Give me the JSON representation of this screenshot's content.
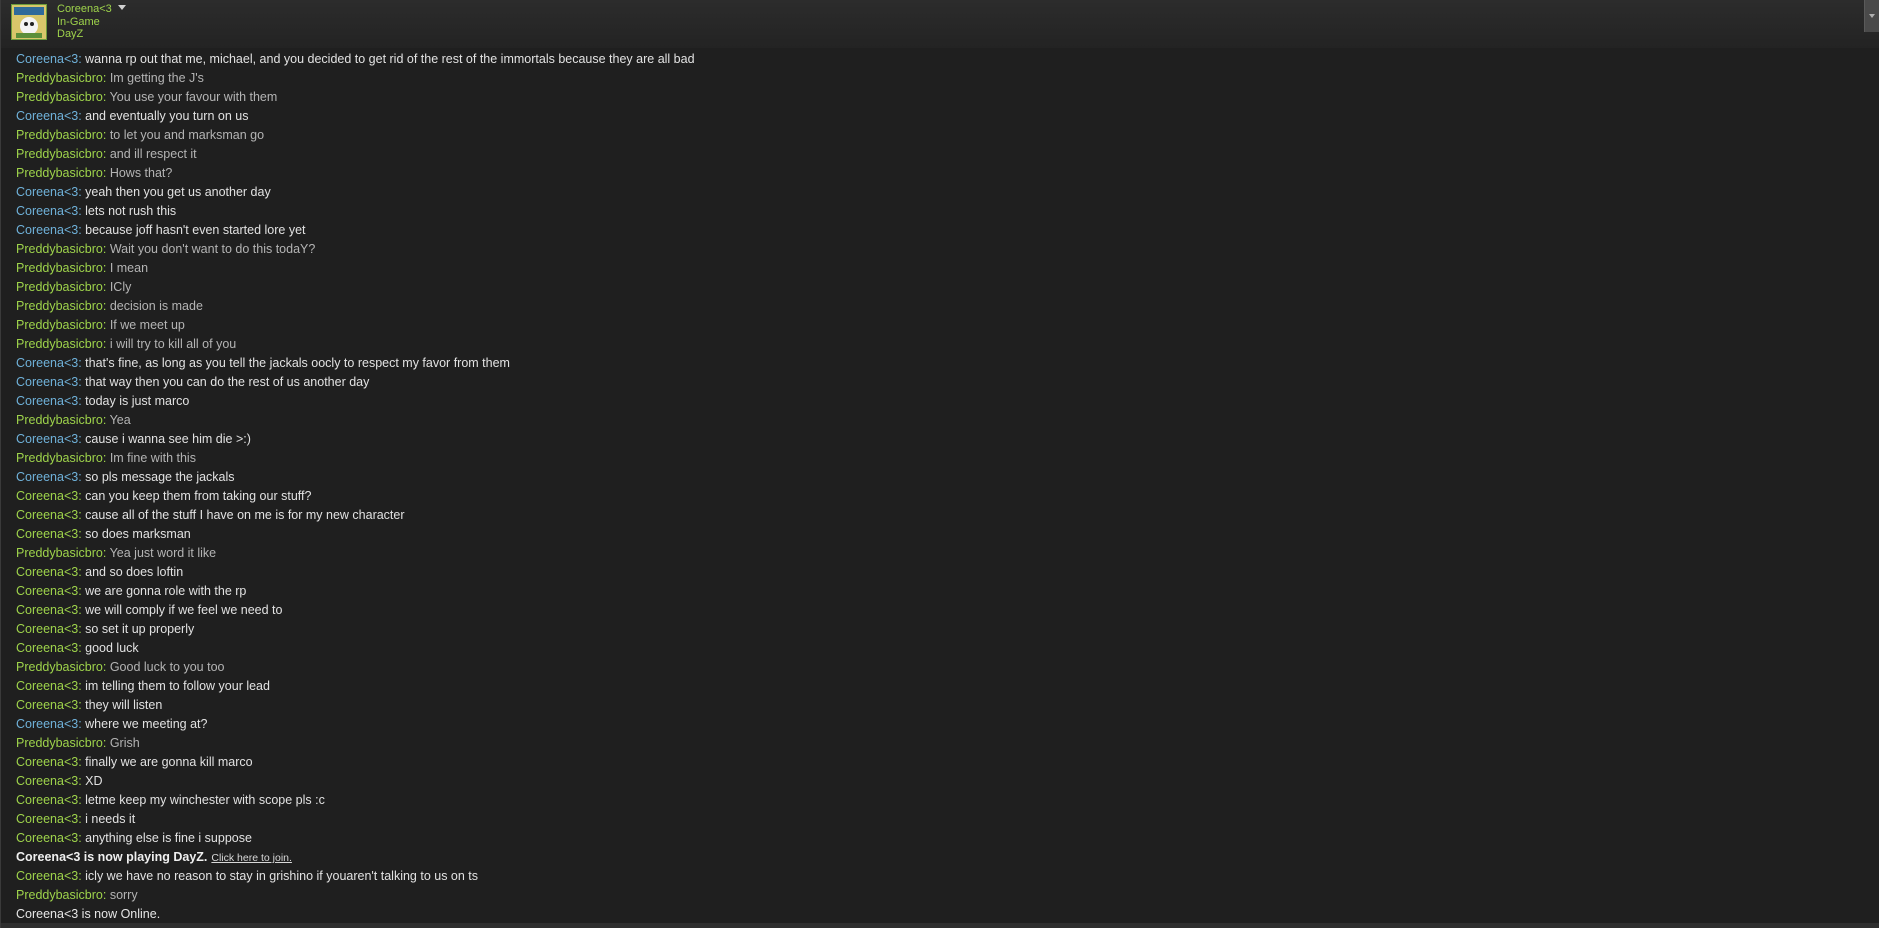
{
  "header": {
    "friend_name": "Coreena<3",
    "status": "In-Game",
    "game": "DayZ"
  },
  "colors": {
    "name_green": "#9ed34b",
    "name_blue": "#6fb1d9",
    "background": "#1f1f1f"
  },
  "messages": [
    {
      "sender": "Coreena<3",
      "sep": ": ",
      "text": "wanna rp out that me, michael, and you decided to get rid of the rest of the immortals because they are all bad",
      "style": "blue"
    },
    {
      "sender": "Preddybasicbro",
      "sep": ": ",
      "text": "Im getting the J's",
      "style": "green"
    },
    {
      "sender": "Preddybasicbro",
      "sep": ": ",
      "text": "You use your favour with them",
      "style": "green"
    },
    {
      "sender": "Coreena<3",
      "sep": ": ",
      "text": "and eventually you turn on us",
      "style": "blue"
    },
    {
      "sender": "Preddybasicbro",
      "sep": ": ",
      "text": "to let you and marksman go",
      "style": "green"
    },
    {
      "sender": "Preddybasicbro",
      "sep": ": ",
      "text": "and ill respect it",
      "style": "green"
    },
    {
      "sender": "Preddybasicbro",
      "sep": ": ",
      "text": "Hows that?",
      "style": "green"
    },
    {
      "sender": "Coreena<3",
      "sep": ": ",
      "text": "yeah then you get us another day",
      "style": "blue"
    },
    {
      "sender": "Coreena<3",
      "sep": ": ",
      "text": "lets not rush this",
      "style": "blue"
    },
    {
      "sender": "Coreena<3",
      "sep": ": ",
      "text": "because joff hasn't even started lore yet",
      "style": "blue"
    },
    {
      "sender": "Preddybasicbro",
      "sep": ": ",
      "text": "Wait you don't want to do this todaY?",
      "style": "green"
    },
    {
      "sender": "Preddybasicbro",
      "sep": ": ",
      "text": "I mean",
      "style": "green"
    },
    {
      "sender": "Preddybasicbro",
      "sep": ": ",
      "text": "ICly",
      "style": "green"
    },
    {
      "sender": "Preddybasicbro",
      "sep": ": ",
      "text": "decision is made",
      "style": "green"
    },
    {
      "sender": "Preddybasicbro",
      "sep": ": ",
      "text": "If we meet up",
      "style": "green"
    },
    {
      "sender": "Preddybasicbro",
      "sep": ": ",
      "text": "i will try to kill all of you",
      "style": "green"
    },
    {
      "sender": "Coreena<3",
      "sep": ": ",
      "text": "that's fine, as long as you tell the jackals oocly to respect my favor from them",
      "style": "blue"
    },
    {
      "sender": "Coreena<3",
      "sep": ": ",
      "text": "that way then you can do the rest of us another day",
      "style": "blue"
    },
    {
      "sender": "Coreena<3",
      "sep": ": ",
      "text": "today is just marco",
      "style": "blue"
    },
    {
      "sender": "Preddybasicbro",
      "sep": ": ",
      "text": "Yea",
      "style": "green"
    },
    {
      "sender": "Coreena<3",
      "sep": ": ",
      "text": "cause i wanna see him die >:)",
      "style": "blue"
    },
    {
      "sender": "Preddybasicbro",
      "sep": ": ",
      "text": "Im fine with this",
      "style": "green"
    },
    {
      "sender": "Coreena<3",
      "sep": ": ",
      "text": "so pls message the jackals",
      "style": "blue"
    },
    {
      "sender": "Coreena<3",
      "sep": ": ",
      "text": "can you keep them from taking our stuff?",
      "style": "green"
    },
    {
      "sender": "Coreena<3",
      "sep": ": ",
      "text": "cause all of the stuff I have on me is for my new character",
      "style": "green"
    },
    {
      "sender": "Coreena<3",
      "sep": ": ",
      "text": "so does marksman",
      "style": "green"
    },
    {
      "sender": "Preddybasicbro",
      "sep": ": ",
      "text": "Yea just word it like",
      "style": "green"
    },
    {
      "sender": "Coreena<3",
      "sep": ": ",
      "text": "and so does loftin",
      "style": "green"
    },
    {
      "sender": "Coreena<3",
      "sep": ": ",
      "text": "we are gonna role with the rp",
      "style": "green"
    },
    {
      "sender": "Coreena<3",
      "sep": ": ",
      "text": "we will comply if we feel we need to",
      "style": "green"
    },
    {
      "sender": "Coreena<3",
      "sep": ": ",
      "text": "so set it up properly",
      "style": "green"
    },
    {
      "sender": "Coreena<3",
      "sep": ": ",
      "text": "good luck",
      "style": "green"
    },
    {
      "sender": "Preddybasicbro",
      "sep": ": ",
      "text": "Good luck to you too",
      "style": "green"
    },
    {
      "sender": "Coreena<3",
      "sep": ": ",
      "text": "im telling them to follow your lead",
      "style": "green"
    },
    {
      "sender": "Coreena<3",
      "sep": ": ",
      "text": "they will listen",
      "style": "green"
    },
    {
      "sender": "Coreena<3",
      "sep": ": ",
      "text": "where we meeting at?",
      "style": "blue"
    },
    {
      "sender": "Preddybasicbro",
      "sep": ": ",
      "text": "Grish",
      "style": "green"
    },
    {
      "sender": "Coreena<3",
      "sep": ": ",
      "text": "finally we are gonna kill marco",
      "style": "green"
    },
    {
      "sender": "Coreena<3",
      "sep": ": ",
      "text": "XD",
      "style": "green"
    },
    {
      "sender": "Coreena<3",
      "sep": ": ",
      "text": "letme keep my winchester with scope pls :c",
      "style": "green"
    },
    {
      "sender": "Coreena<3",
      "sep": ": ",
      "text": "i needs it",
      "style": "green"
    },
    {
      "sender": "Coreena<3",
      "sep": ": ",
      "text": "anything else is fine i suppose",
      "style": "green"
    }
  ],
  "system_playing": {
    "text": "Coreena<3 is now playing DayZ.",
    "link": "Click here to join."
  },
  "messages_after": [
    {
      "sender": "Coreena<3",
      "sep": ": ",
      "text": "icly we have no reason to stay in grishino if youaren't talking to us on ts",
      "style": "green"
    },
    {
      "sender": "Preddybasicbro",
      "sep": ": ",
      "text": "sorry",
      "style": "green"
    }
  ],
  "system_online": {
    "text": "Coreena<3 is now Online."
  }
}
